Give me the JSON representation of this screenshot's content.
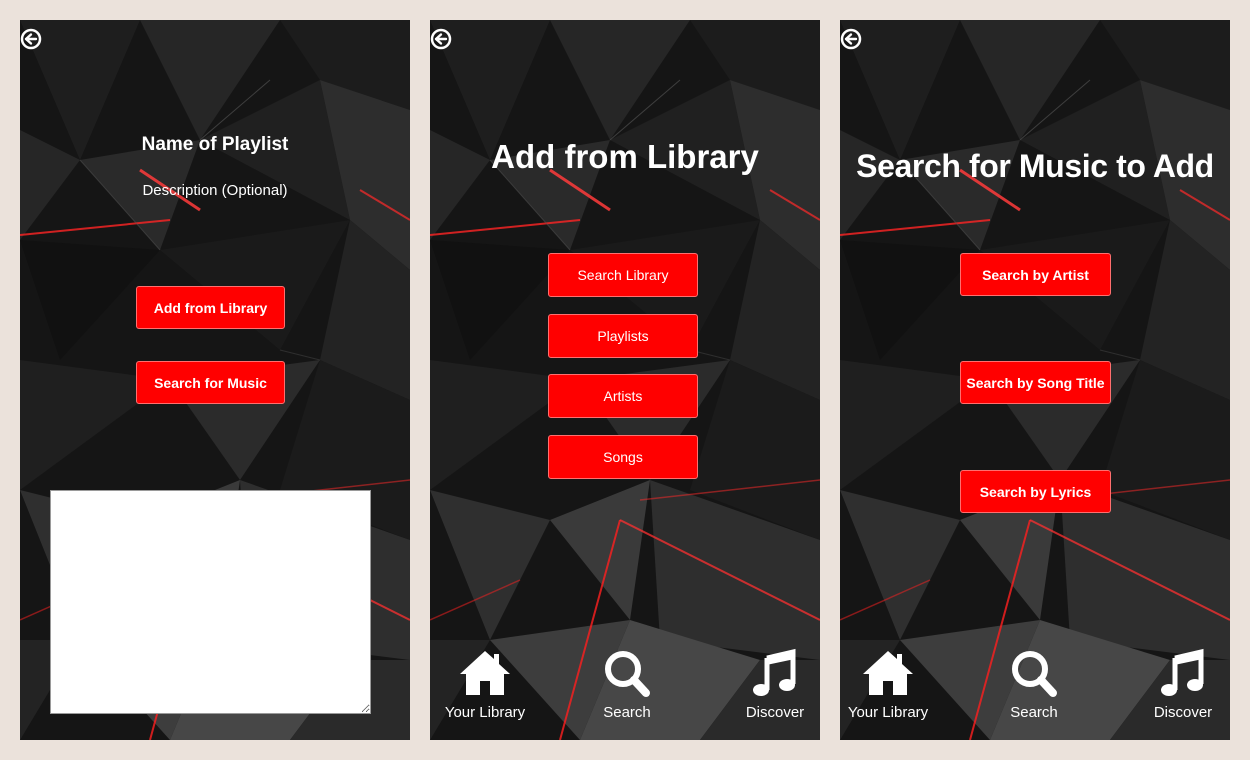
{
  "colors": {
    "page_bg": "#ebe2db",
    "accent": "#ff0000",
    "text": "#ffffff"
  },
  "screen1": {
    "back_icon": "back-arrow-icon",
    "title": "Name of Playlist",
    "description": "Description (Optional)",
    "buttons": [
      "Add from Library",
      "Search for Music"
    ],
    "textarea_value": ""
  },
  "screen2": {
    "back_icon": "back-arrow-icon",
    "title": "Add from Library",
    "buttons": [
      "Search Library",
      "Playlists",
      "Artists",
      "Songs"
    ]
  },
  "screen3": {
    "back_icon": "back-arrow-icon",
    "title": "Search for Music to Add",
    "buttons": [
      "Search by Artist",
      "Search by Song Title",
      "Search by Lyrics"
    ]
  },
  "nav": [
    {
      "icon": "home-icon",
      "label": "Your Library"
    },
    {
      "icon": "search-icon",
      "label": "Search"
    },
    {
      "icon": "music-note-icon",
      "label": "Discover"
    }
  ]
}
